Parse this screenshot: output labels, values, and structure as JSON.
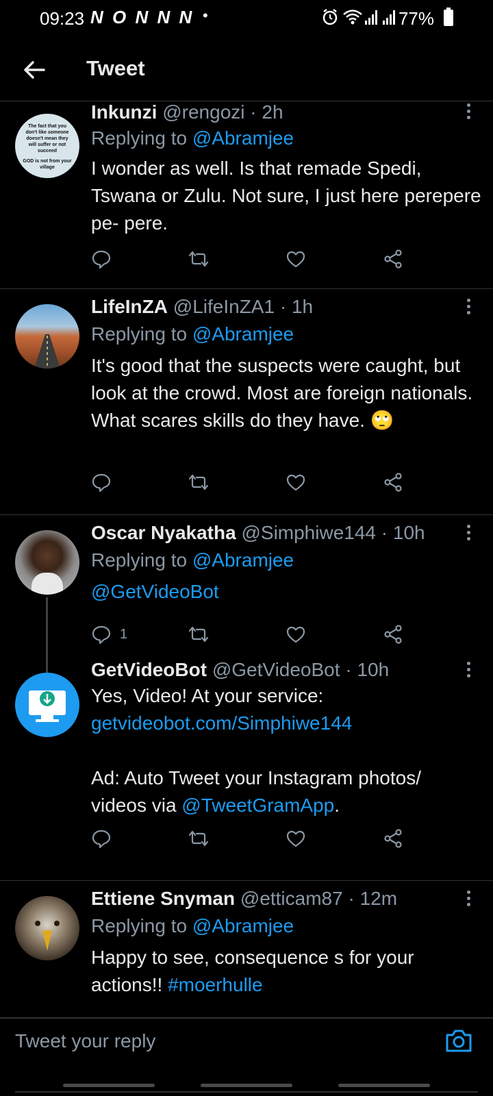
{
  "status_bar": {
    "time": "09:23",
    "notifications": "N O N N N",
    "dot": "•",
    "battery": "77%",
    "icons": [
      "alarm-icon",
      "wifi-icon",
      "signal-icon",
      "signal-icon"
    ]
  },
  "header": {
    "title": "Tweet",
    "back_icon": "arrow-left-icon"
  },
  "tweets": [
    {
      "name": "Inkunzi",
      "handle": "@rengozi",
      "time": "2h",
      "replying_prefix": "Replying to ",
      "replying_to": "@Abramjee",
      "body": "I wonder as well. Is that remade Spedi, Tswana or Zulu. Not sure,  I just here perepere pe- pere.",
      "avatar_text": [
        "The fact that you",
        "don't like someone",
        "doesn't mean they",
        "will suffer or not",
        "succeed",
        "GOD is not from your",
        "village"
      ]
    },
    {
      "name": "LifeInZA",
      "handle": "@LifeInZA1",
      "time": "1h",
      "replying_prefix": "Replying to ",
      "replying_to": "@Abramjee",
      "body": "It's good that the suspects were caught, but look at the crowd. Most are foreign nationals. What scares skills do they have. 🙄"
    },
    {
      "name": "Oscar Nyakatha",
      "handle": "@Simphiwe144",
      "time": "10h",
      "replying_prefix": "Replying to ",
      "replying_to": "@Abramjee",
      "body_mention": "@GetVideoBot",
      "reply_count": "1"
    },
    {
      "name": "GetVideoBot",
      "handle": "@GetVideoBot",
      "time": "10h",
      "body_line1": "Yes, Video! At your service:",
      "body_link": "getvideobot.com/Simphiwe144",
      "body_ad_prefix": "Ad: Auto Tweet your Instagram photos/ videos via ",
      "body_ad_mention": "@TweetGramApp",
      "body_ad_suffix": "."
    },
    {
      "name": "Ettiene Snyman",
      "handle": "@etticam87",
      "time": "12m",
      "replying_prefix": "Replying to ",
      "replying_to": "@Abramjee",
      "body_text": "Happy to see, consequence s for your actions!! ",
      "body_hashtag": "#moerhulle"
    }
  ],
  "separator": " · ",
  "reply_bar": {
    "placeholder": "Tweet your reply",
    "camera_icon": "camera-icon"
  },
  "colors": {
    "background": "#000000",
    "text": "#e7e9ea",
    "muted": "#8b98a5",
    "accent": "#1d9bf0",
    "divider": "#2f3336"
  }
}
